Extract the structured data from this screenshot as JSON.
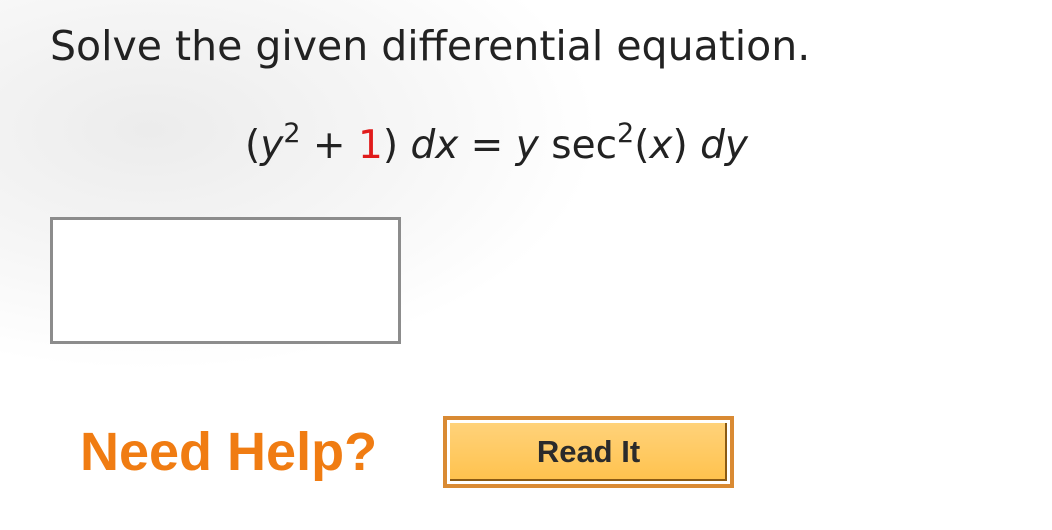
{
  "question": {
    "prompt": "Solve the given differential equation.",
    "equation": {
      "open": "(",
      "y": "y",
      "y_exponent": "2",
      "plus": " + ",
      "constant": "1",
      "close": ") ",
      "dx": "dx",
      "equals": " = ",
      "rhs_y": "y",
      "sec": " sec",
      "sec_exponent": "2",
      "arg_open": "(",
      "arg_x": "x",
      "arg_close": ") ",
      "dy": "dy"
    },
    "answer": {
      "value": "",
      "placeholder": ""
    }
  },
  "help": {
    "label": "Need Help?",
    "read_it_label": "Read It"
  },
  "colors": {
    "constant_highlight": "#e01b1b",
    "need_help": "#f07c12",
    "button_fill": "#ffc24d",
    "button_border": "#d98a33"
  }
}
